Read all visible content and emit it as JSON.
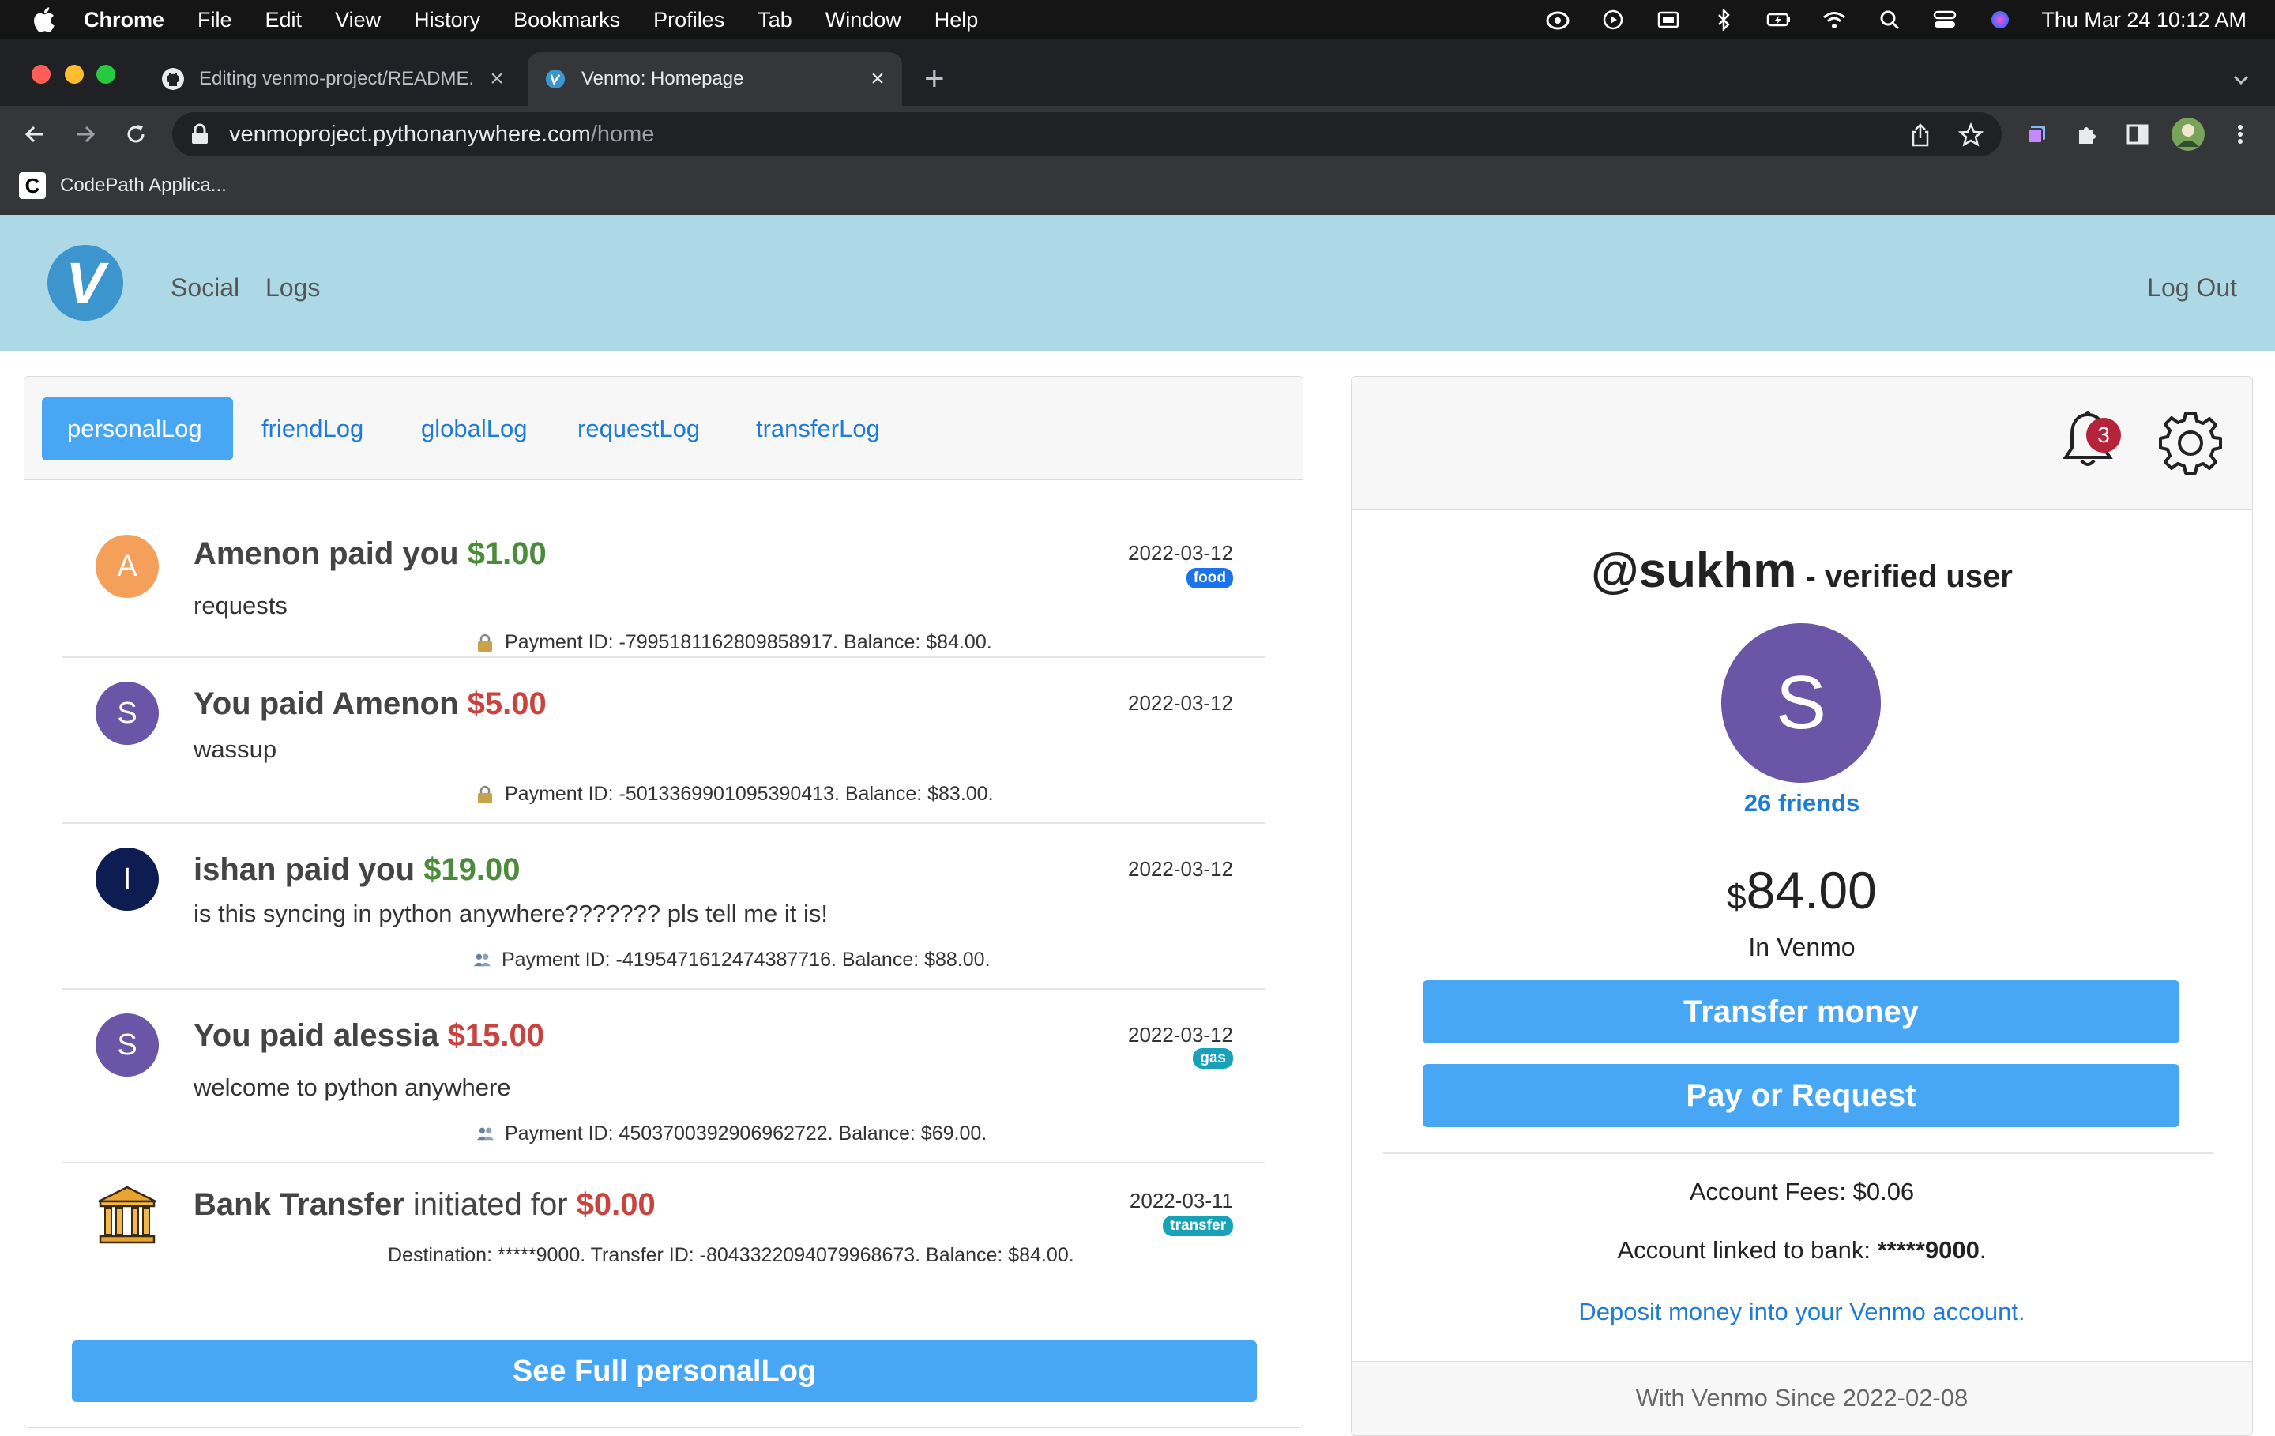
{
  "menubar": {
    "app": "Chrome",
    "items": [
      "File",
      "Edit",
      "View",
      "History",
      "Bookmarks",
      "Profiles",
      "Tab",
      "Window",
      "Help"
    ],
    "clock": "Thu Mar 24  10:12 AM"
  },
  "browser": {
    "tabs": [
      {
        "title": "Editing venmo-project/README.md",
        "icon": "github-icon"
      },
      {
        "title": "Venmo: Homepage",
        "icon": "venmo-icon"
      }
    ],
    "url_host": "venmoproject.pythonanywhere.com",
    "url_path": "/home",
    "bookmark": "CodePath Applica..."
  },
  "nav": {
    "logo": "V",
    "social": "Social",
    "logs": "Logs",
    "logout": "Log Out"
  },
  "log_tabs": [
    "personalLog",
    "friendLog",
    "globalLog",
    "requestLog",
    "transferLog"
  ],
  "log_entries": [
    {
      "avatar": "A",
      "title_before": "Amenon paid you ",
      "amount": "$1.00",
      "date": "2022-03-12",
      "tag": "food",
      "note": "requests",
      "meta": "Payment ID: -7995181162809858917. Balance: $84.00."
    },
    {
      "avatar": "S",
      "title_before": "You paid Amenon ",
      "amount": "$5.00",
      "date": "2022-03-12",
      "tag": "",
      "note": "wassup",
      "meta": "Payment ID: -5013369901095390413. Balance: $83.00."
    },
    {
      "avatar": "I",
      "title_before": "ishan paid you ",
      "amount": "$19.00",
      "date": "2022-03-12",
      "tag": "",
      "note": "is this syncing in python anywhere??????? pls tell me it is!",
      "meta": "Payment ID: -4195471612474387716. Balance: $88.00."
    },
    {
      "avatar": "S",
      "title_before": "You paid alessia ",
      "amount": "$15.00",
      "date": "2022-03-12",
      "tag": "gas",
      "note": "welcome to python anywhere",
      "meta": "Payment ID: 4503700392906962722. Balance: $69.00."
    },
    {
      "title_bold": "Bank Transfer",
      "title_normal": " initiated for ",
      "amount": "$0.00",
      "date": "2022-03-11",
      "tag": "transfer",
      "meta": "Destination: *****9000. Transfer ID: -8043322094079968673. Balance: $84.00."
    }
  ],
  "see_full": "See Full personalLog",
  "profile": {
    "notifications": "3",
    "handle": "@sukhm",
    "verified": " - verified user",
    "initial": "S",
    "friends": "26 friends",
    "currency": "$",
    "balance": "84.00",
    "balance_label": "In Venmo",
    "transfer_btn": "Transfer money",
    "pay_btn": "Pay or Request",
    "fees": "Account Fees: $0.06",
    "bank_prefix": "Account linked to bank: ",
    "bank_account": "*****9000",
    "bank_suffix": ".",
    "deposit": "Deposit money into your Venmo account.",
    "since": "With Venmo Since 2022-02-08"
  },
  "colors": {
    "nav_bg": "#add8e6",
    "primary": "#47a7f4",
    "link": "#1e7bd6",
    "income": "#4b8c3a",
    "expense": "#c9443e"
  }
}
